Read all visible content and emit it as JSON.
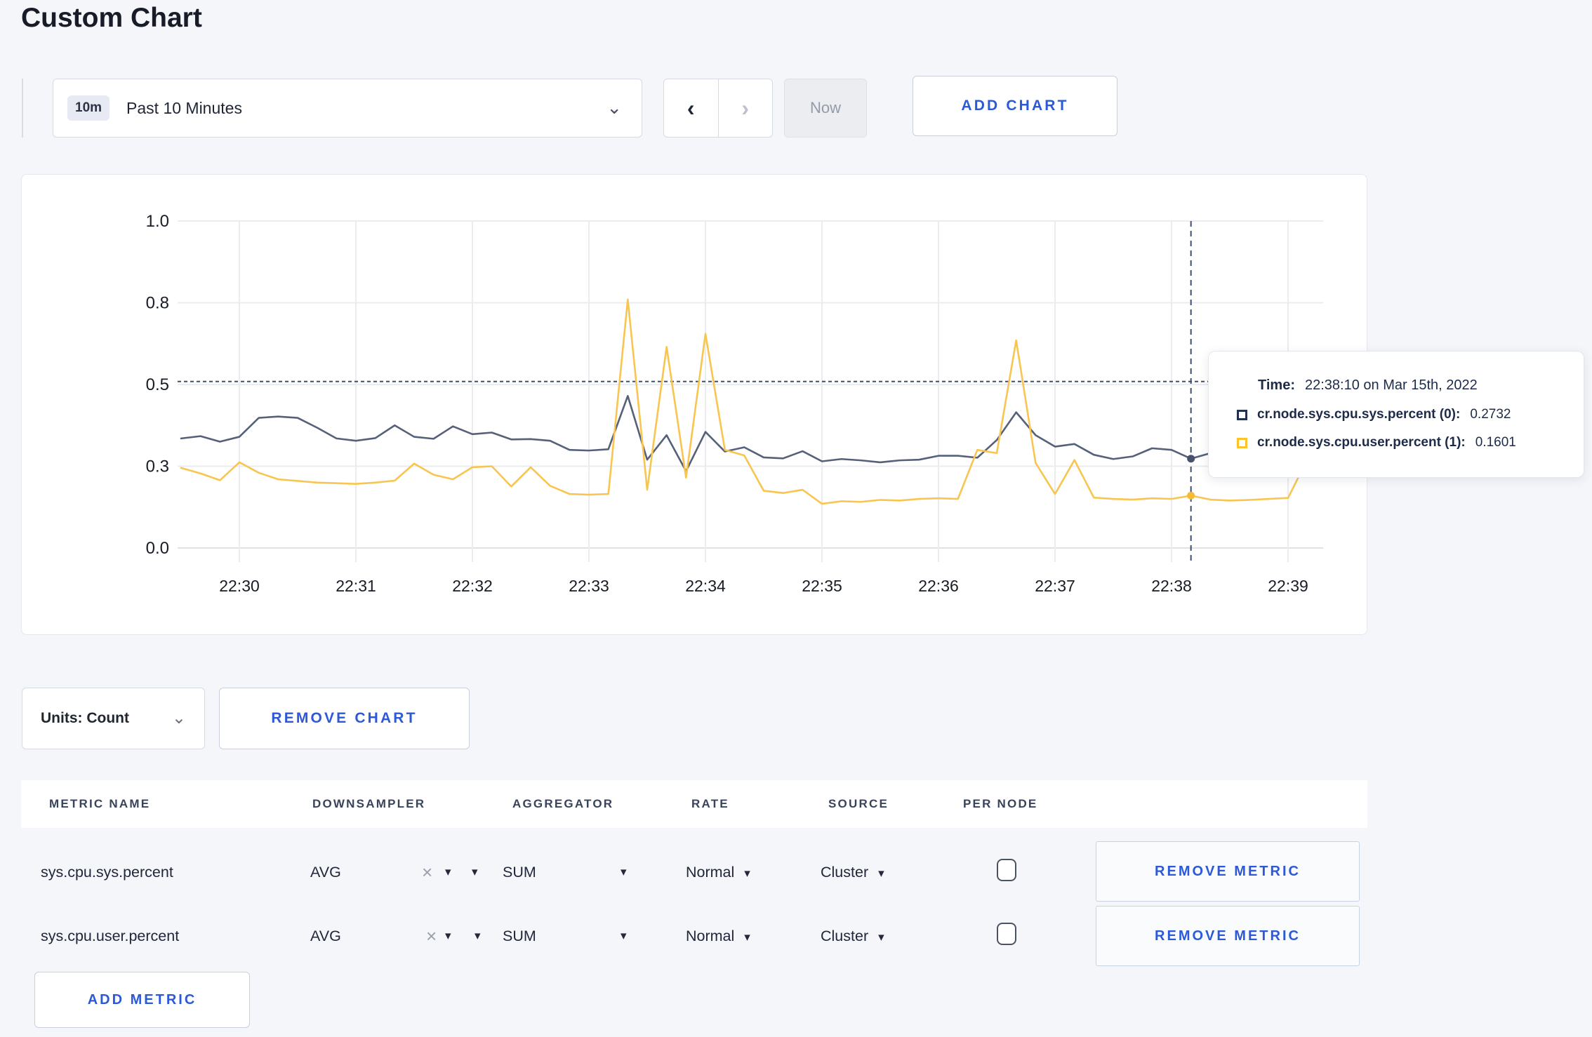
{
  "page": {
    "title": "Custom Chart"
  },
  "icons": {
    "chevron_down": "⌄",
    "caret_down": "▾",
    "close": "×",
    "prev": "‹",
    "next": "›"
  },
  "toolbar": {
    "range_badge": "10m",
    "range_label": "Past 10 Minutes",
    "now_label": "Now",
    "add_chart_label": "ADD CHART"
  },
  "chart_data": {
    "type": "line",
    "title": "",
    "xlabel": "",
    "ylabel": "",
    "x_ticks": [
      "22:30",
      "22:31",
      "22:32",
      "22:33",
      "22:34",
      "22:35",
      "22:36",
      "22:37",
      "22:38",
      "22:39"
    ],
    "y_ticks": [
      {
        "v": 0.0,
        "label": "0.0"
      },
      {
        "v": 0.25,
        "label": "0.3"
      },
      {
        "v": 0.5,
        "label": "0.5"
      },
      {
        "v": 0.75,
        "label": "0.8"
      },
      {
        "v": 1.0,
        "label": "1.0"
      }
    ],
    "ylim": [
      0,
      1
    ],
    "grid": true,
    "legend_position": "none",
    "start_min_before_first_tick": 0.5,
    "point_interval_sec": 10,
    "guide_line_v": 0.509,
    "axis_color": "#181c24",
    "gridline_color": "#ebecef",
    "baseline_color": "#e0e1e5",
    "crosshair": {
      "color": "#3f4e6b",
      "t_min_after_first_tick": 8.1667,
      "time_label": "22:38:10",
      "points": [
        {
          "series": 0,
          "v": 0.2732,
          "dot_color": "#47536d"
        },
        {
          "series": 1,
          "v": 0.1601,
          "dot_color": "#f3bc33"
        }
      ]
    },
    "series": [
      {
        "name": "cr.node.sys.cpu.sys.percent",
        "color": "#566179",
        "values": [
          0.335,
          0.342,
          0.325,
          0.34,
          0.398,
          0.402,
          0.398,
          0.368,
          0.335,
          0.328,
          0.336,
          0.375,
          0.34,
          0.334,
          0.372,
          0.348,
          0.353,
          0.332,
          0.333,
          0.328,
          0.3,
          0.298,
          0.302,
          0.465,
          0.27,
          0.345,
          0.235,
          0.355,
          0.295,
          0.308,
          0.277,
          0.274,
          0.296,
          0.265,
          0.272,
          0.268,
          0.262,
          0.268,
          0.27,
          0.282,
          0.282,
          0.276,
          0.33,
          0.415,
          0.345,
          0.31,
          0.318,
          0.285,
          0.272,
          0.28,
          0.305,
          0.3,
          0.2732,
          0.29,
          0.305,
          0.3,
          0.295,
          0.3,
          0.31,
          0.3
        ]
      },
      {
        "name": "cr.node.sys.cpu.user.percent",
        "color": "#f8c550",
        "values": [
          0.245,
          0.228,
          0.207,
          0.262,
          0.23,
          0.21,
          0.205,
          0.2,
          0.198,
          0.196,
          0.2,
          0.206,
          0.258,
          0.224,
          0.21,
          0.247,
          0.25,
          0.188,
          0.247,
          0.19,
          0.165,
          0.163,
          0.165,
          0.76,
          0.178,
          0.615,
          0.215,
          0.655,
          0.3,
          0.283,
          0.175,
          0.168,
          0.178,
          0.135,
          0.143,
          0.141,
          0.147,
          0.145,
          0.15,
          0.152,
          0.15,
          0.3,
          0.29,
          0.635,
          0.26,
          0.165,
          0.269,
          0.154,
          0.15,
          0.148,
          0.152,
          0.15,
          0.1601,
          0.148,
          0.145,
          0.147,
          0.15,
          0.153,
          0.272,
          0.24
        ]
      }
    ]
  },
  "tooltip": {
    "time_label": "Time:",
    "time_value": "22:38:10 on Mar 15th, 2022",
    "rows": [
      {
        "label": "cr.node.sys.cpu.sys.percent (0):",
        "value": "0.2732",
        "swatch": "#243052"
      },
      {
        "label": "cr.node.sys.cpu.user.percent (1):",
        "value": "0.1601",
        "swatch": "#fcc32a"
      }
    ]
  },
  "controls": {
    "units_label": "Units: Count",
    "remove_chart_label": "REMOVE CHART",
    "remove_metric_label": "REMOVE METRIC",
    "add_metric_label": "ADD METRIC"
  },
  "table": {
    "headers": [
      "METRIC NAME",
      "DOWNSAMPLER",
      "AGGREGATOR",
      "RATE",
      "SOURCE",
      "PER NODE"
    ],
    "rows": [
      {
        "metric": "sys.cpu.sys.percent",
        "downsampler": "AVG",
        "aggregator": "SUM",
        "rate": "Normal",
        "source": "Cluster",
        "per_node": false
      },
      {
        "metric": "sys.cpu.user.percent",
        "downsampler": "AVG",
        "aggregator": "SUM",
        "rate": "Normal",
        "source": "Cluster",
        "per_node": false
      }
    ]
  }
}
